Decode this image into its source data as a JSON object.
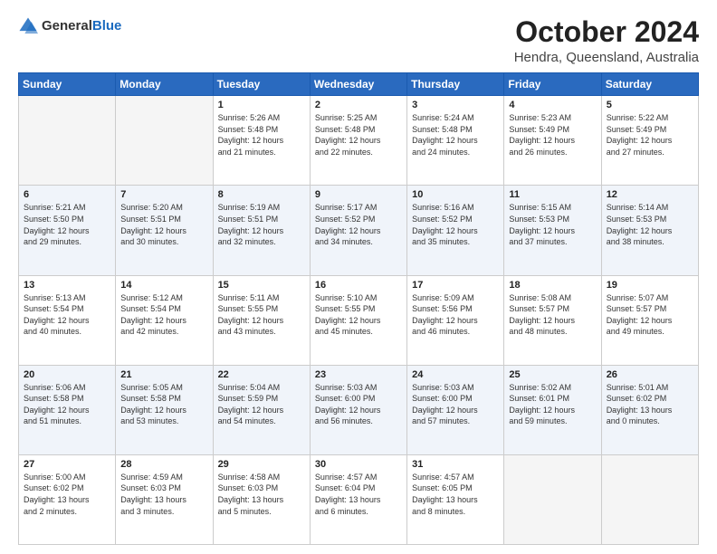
{
  "header": {
    "logo_general": "General",
    "logo_blue": "Blue",
    "month_title": "October 2024",
    "location": "Hendra, Queensland, Australia"
  },
  "weekdays": [
    "Sunday",
    "Monday",
    "Tuesday",
    "Wednesday",
    "Thursday",
    "Friday",
    "Saturday"
  ],
  "rows": [
    [
      {
        "day": "",
        "info": ""
      },
      {
        "day": "",
        "info": ""
      },
      {
        "day": "1",
        "info": "Sunrise: 5:26 AM\nSunset: 5:48 PM\nDaylight: 12 hours\nand 21 minutes."
      },
      {
        "day": "2",
        "info": "Sunrise: 5:25 AM\nSunset: 5:48 PM\nDaylight: 12 hours\nand 22 minutes."
      },
      {
        "day": "3",
        "info": "Sunrise: 5:24 AM\nSunset: 5:48 PM\nDaylight: 12 hours\nand 24 minutes."
      },
      {
        "day": "4",
        "info": "Sunrise: 5:23 AM\nSunset: 5:49 PM\nDaylight: 12 hours\nand 26 minutes."
      },
      {
        "day": "5",
        "info": "Sunrise: 5:22 AM\nSunset: 5:49 PM\nDaylight: 12 hours\nand 27 minutes."
      }
    ],
    [
      {
        "day": "6",
        "info": "Sunrise: 5:21 AM\nSunset: 5:50 PM\nDaylight: 12 hours\nand 29 minutes."
      },
      {
        "day": "7",
        "info": "Sunrise: 5:20 AM\nSunset: 5:51 PM\nDaylight: 12 hours\nand 30 minutes."
      },
      {
        "day": "8",
        "info": "Sunrise: 5:19 AM\nSunset: 5:51 PM\nDaylight: 12 hours\nand 32 minutes."
      },
      {
        "day": "9",
        "info": "Sunrise: 5:17 AM\nSunset: 5:52 PM\nDaylight: 12 hours\nand 34 minutes."
      },
      {
        "day": "10",
        "info": "Sunrise: 5:16 AM\nSunset: 5:52 PM\nDaylight: 12 hours\nand 35 minutes."
      },
      {
        "day": "11",
        "info": "Sunrise: 5:15 AM\nSunset: 5:53 PM\nDaylight: 12 hours\nand 37 minutes."
      },
      {
        "day": "12",
        "info": "Sunrise: 5:14 AM\nSunset: 5:53 PM\nDaylight: 12 hours\nand 38 minutes."
      }
    ],
    [
      {
        "day": "13",
        "info": "Sunrise: 5:13 AM\nSunset: 5:54 PM\nDaylight: 12 hours\nand 40 minutes."
      },
      {
        "day": "14",
        "info": "Sunrise: 5:12 AM\nSunset: 5:54 PM\nDaylight: 12 hours\nand 42 minutes."
      },
      {
        "day": "15",
        "info": "Sunrise: 5:11 AM\nSunset: 5:55 PM\nDaylight: 12 hours\nand 43 minutes."
      },
      {
        "day": "16",
        "info": "Sunrise: 5:10 AM\nSunset: 5:55 PM\nDaylight: 12 hours\nand 45 minutes."
      },
      {
        "day": "17",
        "info": "Sunrise: 5:09 AM\nSunset: 5:56 PM\nDaylight: 12 hours\nand 46 minutes."
      },
      {
        "day": "18",
        "info": "Sunrise: 5:08 AM\nSunset: 5:57 PM\nDaylight: 12 hours\nand 48 minutes."
      },
      {
        "day": "19",
        "info": "Sunrise: 5:07 AM\nSunset: 5:57 PM\nDaylight: 12 hours\nand 49 minutes."
      }
    ],
    [
      {
        "day": "20",
        "info": "Sunrise: 5:06 AM\nSunset: 5:58 PM\nDaylight: 12 hours\nand 51 minutes."
      },
      {
        "day": "21",
        "info": "Sunrise: 5:05 AM\nSunset: 5:58 PM\nDaylight: 12 hours\nand 53 minutes."
      },
      {
        "day": "22",
        "info": "Sunrise: 5:04 AM\nSunset: 5:59 PM\nDaylight: 12 hours\nand 54 minutes."
      },
      {
        "day": "23",
        "info": "Sunrise: 5:03 AM\nSunset: 6:00 PM\nDaylight: 12 hours\nand 56 minutes."
      },
      {
        "day": "24",
        "info": "Sunrise: 5:03 AM\nSunset: 6:00 PM\nDaylight: 12 hours\nand 57 minutes."
      },
      {
        "day": "25",
        "info": "Sunrise: 5:02 AM\nSunset: 6:01 PM\nDaylight: 12 hours\nand 59 minutes."
      },
      {
        "day": "26",
        "info": "Sunrise: 5:01 AM\nSunset: 6:02 PM\nDaylight: 13 hours\nand 0 minutes."
      }
    ],
    [
      {
        "day": "27",
        "info": "Sunrise: 5:00 AM\nSunset: 6:02 PM\nDaylight: 13 hours\nand 2 minutes."
      },
      {
        "day": "28",
        "info": "Sunrise: 4:59 AM\nSunset: 6:03 PM\nDaylight: 13 hours\nand 3 minutes."
      },
      {
        "day": "29",
        "info": "Sunrise: 4:58 AM\nSunset: 6:03 PM\nDaylight: 13 hours\nand 5 minutes."
      },
      {
        "day": "30",
        "info": "Sunrise: 4:57 AM\nSunset: 6:04 PM\nDaylight: 13 hours\nand 6 minutes."
      },
      {
        "day": "31",
        "info": "Sunrise: 4:57 AM\nSunset: 6:05 PM\nDaylight: 13 hours\nand 8 minutes."
      },
      {
        "day": "",
        "info": ""
      },
      {
        "day": "",
        "info": ""
      }
    ]
  ]
}
